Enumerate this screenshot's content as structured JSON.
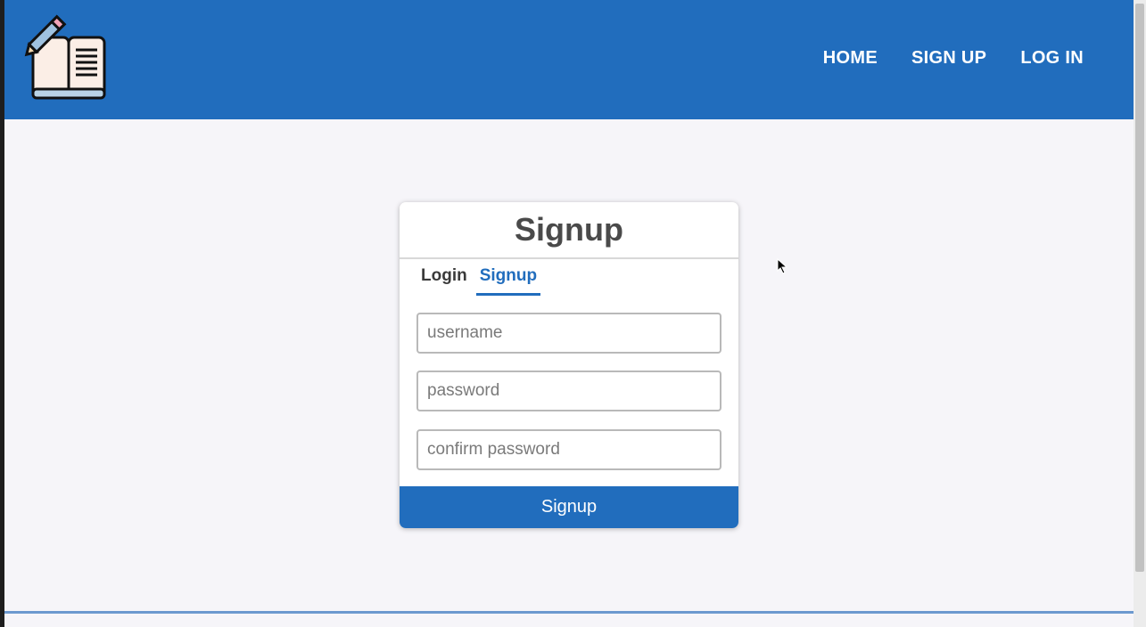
{
  "nav": {
    "links": [
      "HOME",
      "SIGN UP",
      "LOG IN"
    ],
    "logo_icon": "book-pencil-icon"
  },
  "card": {
    "title": "Signup",
    "tabs": [
      {
        "label": "Login",
        "active": false
      },
      {
        "label": "Signup",
        "active": true
      }
    ],
    "fields": {
      "username_placeholder": "username",
      "password_placeholder": "password",
      "confirm_placeholder": "confirm password"
    },
    "submit_label": "Signup"
  },
  "colors": {
    "brand": "#216dbd",
    "background": "#f6f5f9",
    "title_text": "#4a4a4a"
  }
}
